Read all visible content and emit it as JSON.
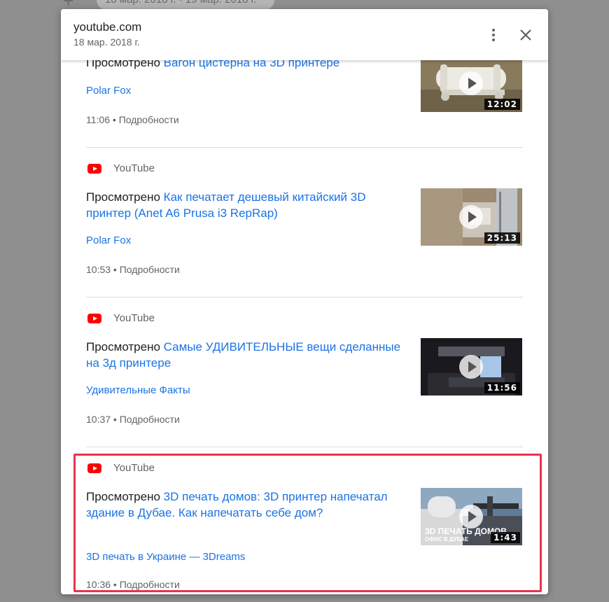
{
  "background": {
    "date_chip": "18 мар. 2018 г. - 19 мар. 2018 г.",
    "add_symbol": "+"
  },
  "dialog": {
    "title": "youtube.com",
    "date": "18 мар. 2018 г.",
    "more_icon": "more-vert-icon",
    "close_icon": "close-icon"
  },
  "entries": [
    {
      "source": "",
      "prefix": "Просмотрено ",
      "link_text": "Вагон цистерна на 3D принтере",
      "channel": "Polar Fox",
      "time": "11:06",
      "separator": " • ",
      "details_label": "Подробности",
      "duration": "12:02"
    },
    {
      "source": "YouTube",
      "prefix": "Просмотрено ",
      "link_text": "Как печатает дешевый китайский 3D принтер (Anet A6 Prusa i3 RepRap)",
      "channel": "Polar Fox",
      "time": "10:53",
      "separator": " • ",
      "details_label": "Подробности",
      "duration": "25:13"
    },
    {
      "source": "YouTube",
      "prefix": "Просмотрено ",
      "link_text": "Самые УДИВИТЕЛЬНЫЕ вещи сделанные на 3д принтере",
      "channel": "Удивительные Факты",
      "time": "10:37",
      "separator": " • ",
      "details_label": "Подробности",
      "duration": "11:56"
    },
    {
      "source": "YouTube",
      "prefix": "Просмотрено ",
      "link_text": "3D печать домов: 3D принтер напечатал здание в Дубае. Как напечатать себе дом?",
      "channel": "3D печать в Украине — 3Dreams",
      "time": "10:36",
      "separator": " • ",
      "details_label": "Подробности",
      "duration": "1:43",
      "thumb_caption": "3D ПЕЧАТЬ ДОМОВ",
      "thumb_subcaption": "ОФИС В ДУБАЕ"
    }
  ],
  "colors": {
    "link": "#1a73e8",
    "youtube_red": "#ff0000",
    "highlight": "#e8344c"
  }
}
